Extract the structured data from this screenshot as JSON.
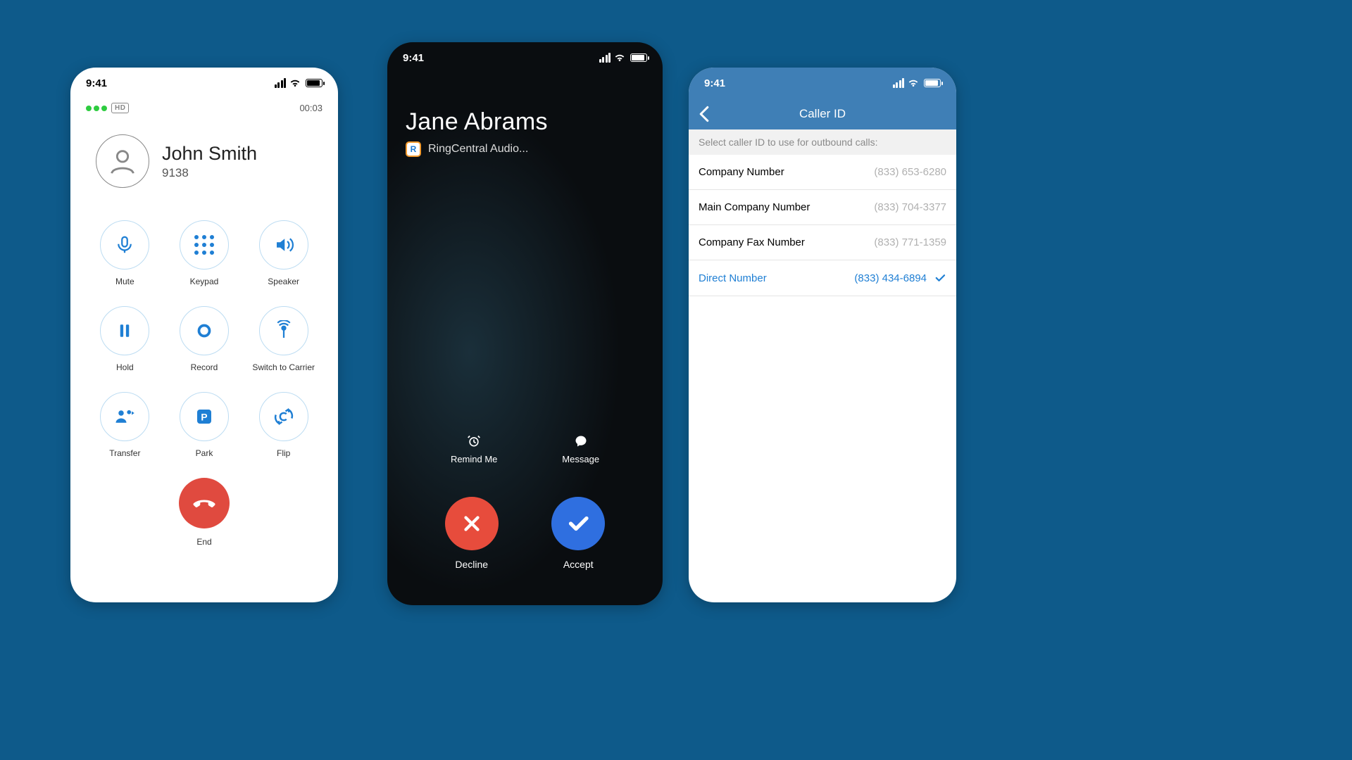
{
  "status_time": "9:41",
  "phone1": {
    "hd": "HD",
    "duration": "00:03",
    "caller_name": "John Smith",
    "caller_ext": "9138",
    "buttons": {
      "mute": "Mute",
      "keypad": "Keypad",
      "speaker": "Speaker",
      "hold": "Hold",
      "record": "Record",
      "switch": "Switch to Carrier",
      "transfer": "Transfer",
      "park": "Park",
      "flip": "Flip"
    },
    "end_label": "End"
  },
  "phone2": {
    "caller_name": "Jane Abrams",
    "subtitle": "RingCentral Audio...",
    "rc_badge": "R",
    "remind_label": "Remind Me",
    "message_label": "Message",
    "decline_label": "Decline",
    "accept_label": "Accept"
  },
  "phone3": {
    "title": "Caller ID",
    "instruction": "Select caller ID to use for outbound calls:",
    "items": [
      {
        "label": "Company Number",
        "number": "(833) 653-6280",
        "selected": false
      },
      {
        "label": "Main Company Number",
        "number": "(833) 704-3377",
        "selected": false
      },
      {
        "label": "Company Fax Number",
        "number": "(833) 771-1359",
        "selected": false
      },
      {
        "label": "Direct Number",
        "number": "(833) 434-6894",
        "selected": true
      }
    ]
  }
}
